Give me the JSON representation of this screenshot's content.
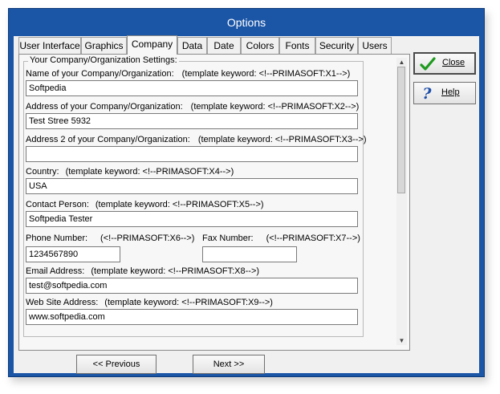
{
  "window": {
    "title": "Options"
  },
  "tabs": [
    {
      "label": "User Interface"
    },
    {
      "label": "Graphics"
    },
    {
      "label": "Company",
      "active": true
    },
    {
      "label": "Data"
    },
    {
      "label": "Date"
    },
    {
      "label": "Colors"
    },
    {
      "label": "Fonts"
    },
    {
      "label": "Security"
    },
    {
      "label": "Users"
    }
  ],
  "group": {
    "title": "Your Company/Organization Settings:"
  },
  "fields": {
    "name": {
      "label": "Name of your Company/Organization:",
      "keyword": "(template keyword: <!--PRIMASOFT:X1-->)",
      "value": "Softpedia"
    },
    "address": {
      "label": "Address of your Company/Organization:",
      "keyword": "(template keyword: <!--PRIMASOFT:X2-->)",
      "value": "Test Stree 5932"
    },
    "address2": {
      "label": "Address 2 of your Company/Organization:",
      "keyword": "(template keyword: <!--PRIMASOFT:X3-->)",
      "value": ""
    },
    "country": {
      "label": "Country:",
      "keyword": "(template keyword: <!--PRIMASOFT:X4-->)",
      "value": "USA"
    },
    "contact": {
      "label": "Contact Person:",
      "keyword": "(template keyword: <!--PRIMASOFT:X5-->)",
      "value": "Softpedia Tester"
    },
    "phone": {
      "label": "Phone Number:",
      "keyword": "(<!--PRIMASOFT:X6-->)",
      "value": "1234567890"
    },
    "fax": {
      "label": "Fax Number:",
      "keyword": "(<!--PRIMASOFT:X7-->)",
      "value": ""
    },
    "email": {
      "label": "Email Address:",
      "keyword": "(template keyword: <!--PRIMASOFT:X8-->)",
      "value": "test@softpedia.com"
    },
    "web": {
      "label": "Web Site Address:",
      "keyword": "(template keyword: <!--PRIMASOFT:X9-->)",
      "value": "www.softpedia.com"
    }
  },
  "buttons": {
    "close": "Close",
    "help": "Help",
    "previous": "<< Previous",
    "next": "Next >>"
  },
  "icons": {
    "close": "green-checkmark-icon",
    "help": "blue-question-mark-icon"
  },
  "colors": {
    "titlebar": "#1b55a6",
    "checkmark": "#1e9a1e",
    "help": "#1f4fa8"
  }
}
